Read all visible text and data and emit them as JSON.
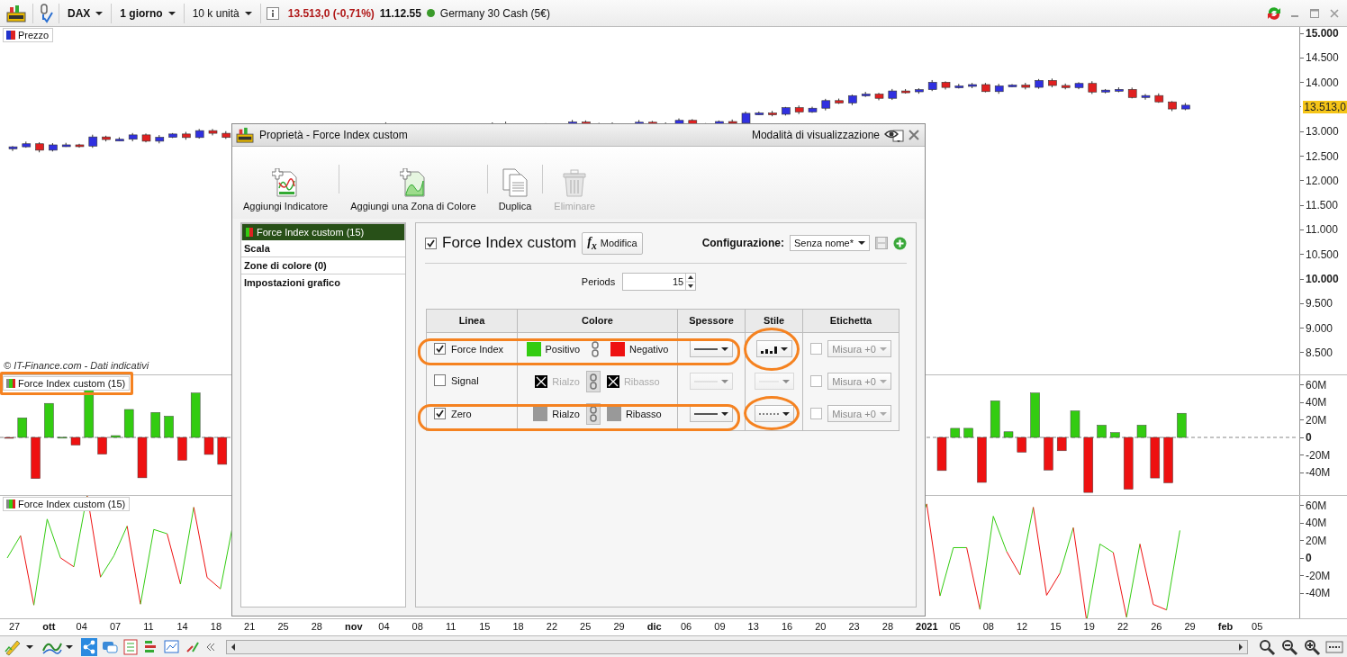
{
  "toolbar": {
    "instrument": "DAX",
    "timeframe": "1 giorno",
    "units": "10 k unità",
    "price": "13.513,0 (-0,71%)",
    "time": "11.12.55",
    "market": "Germany 30 Cash (5€)",
    "market_open": true
  },
  "chart": {
    "price_label": "Prezzo",
    "copyright": "© IT-Finance.com - Dati indicativi",
    "price_ticks": [
      {
        "label": "15.000",
        "kind": "major"
      },
      {
        "label": "14.500",
        "kind": "minor"
      },
      {
        "label": "14.000",
        "kind": "minor"
      },
      {
        "label": "13.513,0",
        "kind": "current"
      },
      {
        "label": "13.000",
        "kind": "minor"
      },
      {
        "label": "12.500",
        "kind": "minor"
      },
      {
        "label": "12.000",
        "kind": "minor"
      },
      {
        "label": "11.500",
        "kind": "minor"
      },
      {
        "label": "11.000",
        "kind": "minor"
      },
      {
        "label": "10.500",
        "kind": "minor"
      },
      {
        "label": "10.000",
        "kind": "major"
      },
      {
        "label": "9.500",
        "kind": "minor"
      },
      {
        "label": "9.000",
        "kind": "minor"
      },
      {
        "label": "8.500",
        "kind": "minor"
      }
    ],
    "panes": [
      {
        "label": "Force Index custom (15)",
        "kind": "histogram",
        "ticks": [
          {
            "label": "60M",
            "kind": "minor"
          },
          {
            "label": "40M",
            "kind": "minor"
          },
          {
            "label": "20M",
            "kind": "minor"
          },
          {
            "label": "0",
            "kind": "major"
          },
          {
            "label": "-20M",
            "kind": "minor"
          },
          {
            "label": "-40M",
            "kind": "minor"
          }
        ]
      },
      {
        "label": "Force Index custom (15)",
        "kind": "line",
        "ticks": [
          {
            "label": "60M",
            "kind": "minor"
          },
          {
            "label": "40M",
            "kind": "minor"
          },
          {
            "label": "20M",
            "kind": "minor"
          },
          {
            "label": "0",
            "kind": "major"
          },
          {
            "label": "-20M",
            "kind": "minor"
          },
          {
            "label": "-40M",
            "kind": "minor"
          }
        ]
      }
    ],
    "dates": [
      {
        "label": "27",
        "kind": "day"
      },
      {
        "label": "ott",
        "kind": "month"
      },
      {
        "label": "04",
        "kind": "day"
      },
      {
        "label": "07",
        "kind": "day"
      },
      {
        "label": "11",
        "kind": "day"
      },
      {
        "label": "14",
        "kind": "day"
      },
      {
        "label": "18",
        "kind": "day"
      },
      {
        "label": "21",
        "kind": "day"
      },
      {
        "label": "25",
        "kind": "day"
      },
      {
        "label": "28",
        "kind": "day"
      },
      {
        "label": "nov",
        "kind": "month"
      },
      {
        "label": "04",
        "kind": "day"
      },
      {
        "label": "08",
        "kind": "day"
      },
      {
        "label": "11",
        "kind": "day"
      },
      {
        "label": "15",
        "kind": "day"
      },
      {
        "label": "18",
        "kind": "day"
      },
      {
        "label": "22",
        "kind": "day"
      },
      {
        "label": "25",
        "kind": "day"
      },
      {
        "label": "29",
        "kind": "day"
      },
      {
        "label": "dic",
        "kind": "month"
      },
      {
        "label": "06",
        "kind": "day"
      },
      {
        "label": "09",
        "kind": "day"
      },
      {
        "label": "13",
        "kind": "day"
      },
      {
        "label": "16",
        "kind": "day"
      },
      {
        "label": "20",
        "kind": "day"
      },
      {
        "label": "23",
        "kind": "day"
      },
      {
        "label": "28",
        "kind": "day"
      },
      {
        "label": "2021",
        "kind": "month"
      },
      {
        "label": "05",
        "kind": "day"
      },
      {
        "label": "08",
        "kind": "day"
      },
      {
        "label": "12",
        "kind": "day"
      },
      {
        "label": "15",
        "kind": "day"
      },
      {
        "label": "19",
        "kind": "day"
      },
      {
        "label": "22",
        "kind": "day"
      },
      {
        "label": "26",
        "kind": "day"
      },
      {
        "label": "29",
        "kind": "day"
      },
      {
        "label": "feb",
        "kind": "month"
      },
      {
        "label": "05",
        "kind": "day"
      }
    ]
  },
  "dialog": {
    "title": "Proprietà - Force Index custom",
    "view_mode": "Modalità di visualizzazione",
    "actions": [
      {
        "label": "Aggiungi Indicatore",
        "kind": "add-indicator",
        "disabled": false
      },
      {
        "label": "Aggiungi una Zona di Colore",
        "kind": "add-zone",
        "disabled": false
      },
      {
        "label": "Duplica",
        "kind": "duplicate",
        "disabled": false
      },
      {
        "label": "Eliminare",
        "kind": "delete",
        "disabled": true
      }
    ],
    "sidebar": [
      {
        "label": "Force Index custom (15)",
        "selected": true
      },
      {
        "label": "Scala",
        "selected": false
      },
      {
        "label": "Zone di colore (0)",
        "selected": false
      },
      {
        "label": "Impostazioni grafico",
        "selected": false
      }
    ],
    "indicator": {
      "name": "Force Index custom",
      "checked": true,
      "edit": "Modifica",
      "edit_icon": "f$_{x}$",
      "config_label": "Configurazione:",
      "config": "Senza nome*",
      "periods_label": "Periods",
      "periods": "15"
    },
    "columns": [
      "Linea",
      "Colore",
      "Spessore",
      "Stile",
      "Etichetta"
    ],
    "rows": [
      {
        "name": "Force Index",
        "checked": true,
        "highlighted": true,
        "colors": [
          {
            "label": "Positivo",
            "color": "#33cc11"
          },
          {
            "label": "Negativo",
            "color": "#ee1111"
          }
        ],
        "label_checked": false,
        "label_option": "Misura +0"
      },
      {
        "name": "Signal",
        "checked": false,
        "highlighted": false,
        "colors": [
          {
            "label": "Rialzo",
            "color": "#000000",
            "kind": "none"
          },
          {
            "label": "Ribasso",
            "color": "#000000",
            "kind": "none"
          }
        ],
        "label_checked": false,
        "label_option": "Misura +0"
      },
      {
        "name": "Zero",
        "checked": true,
        "highlighted": true,
        "colors": [
          {
            "label": "Rialzo",
            "color": "#999999"
          },
          {
            "label": "Ribasso",
            "color": "#999999"
          }
        ],
        "label_checked": false,
        "label_option": "Misura +0"
      }
    ]
  }
}
